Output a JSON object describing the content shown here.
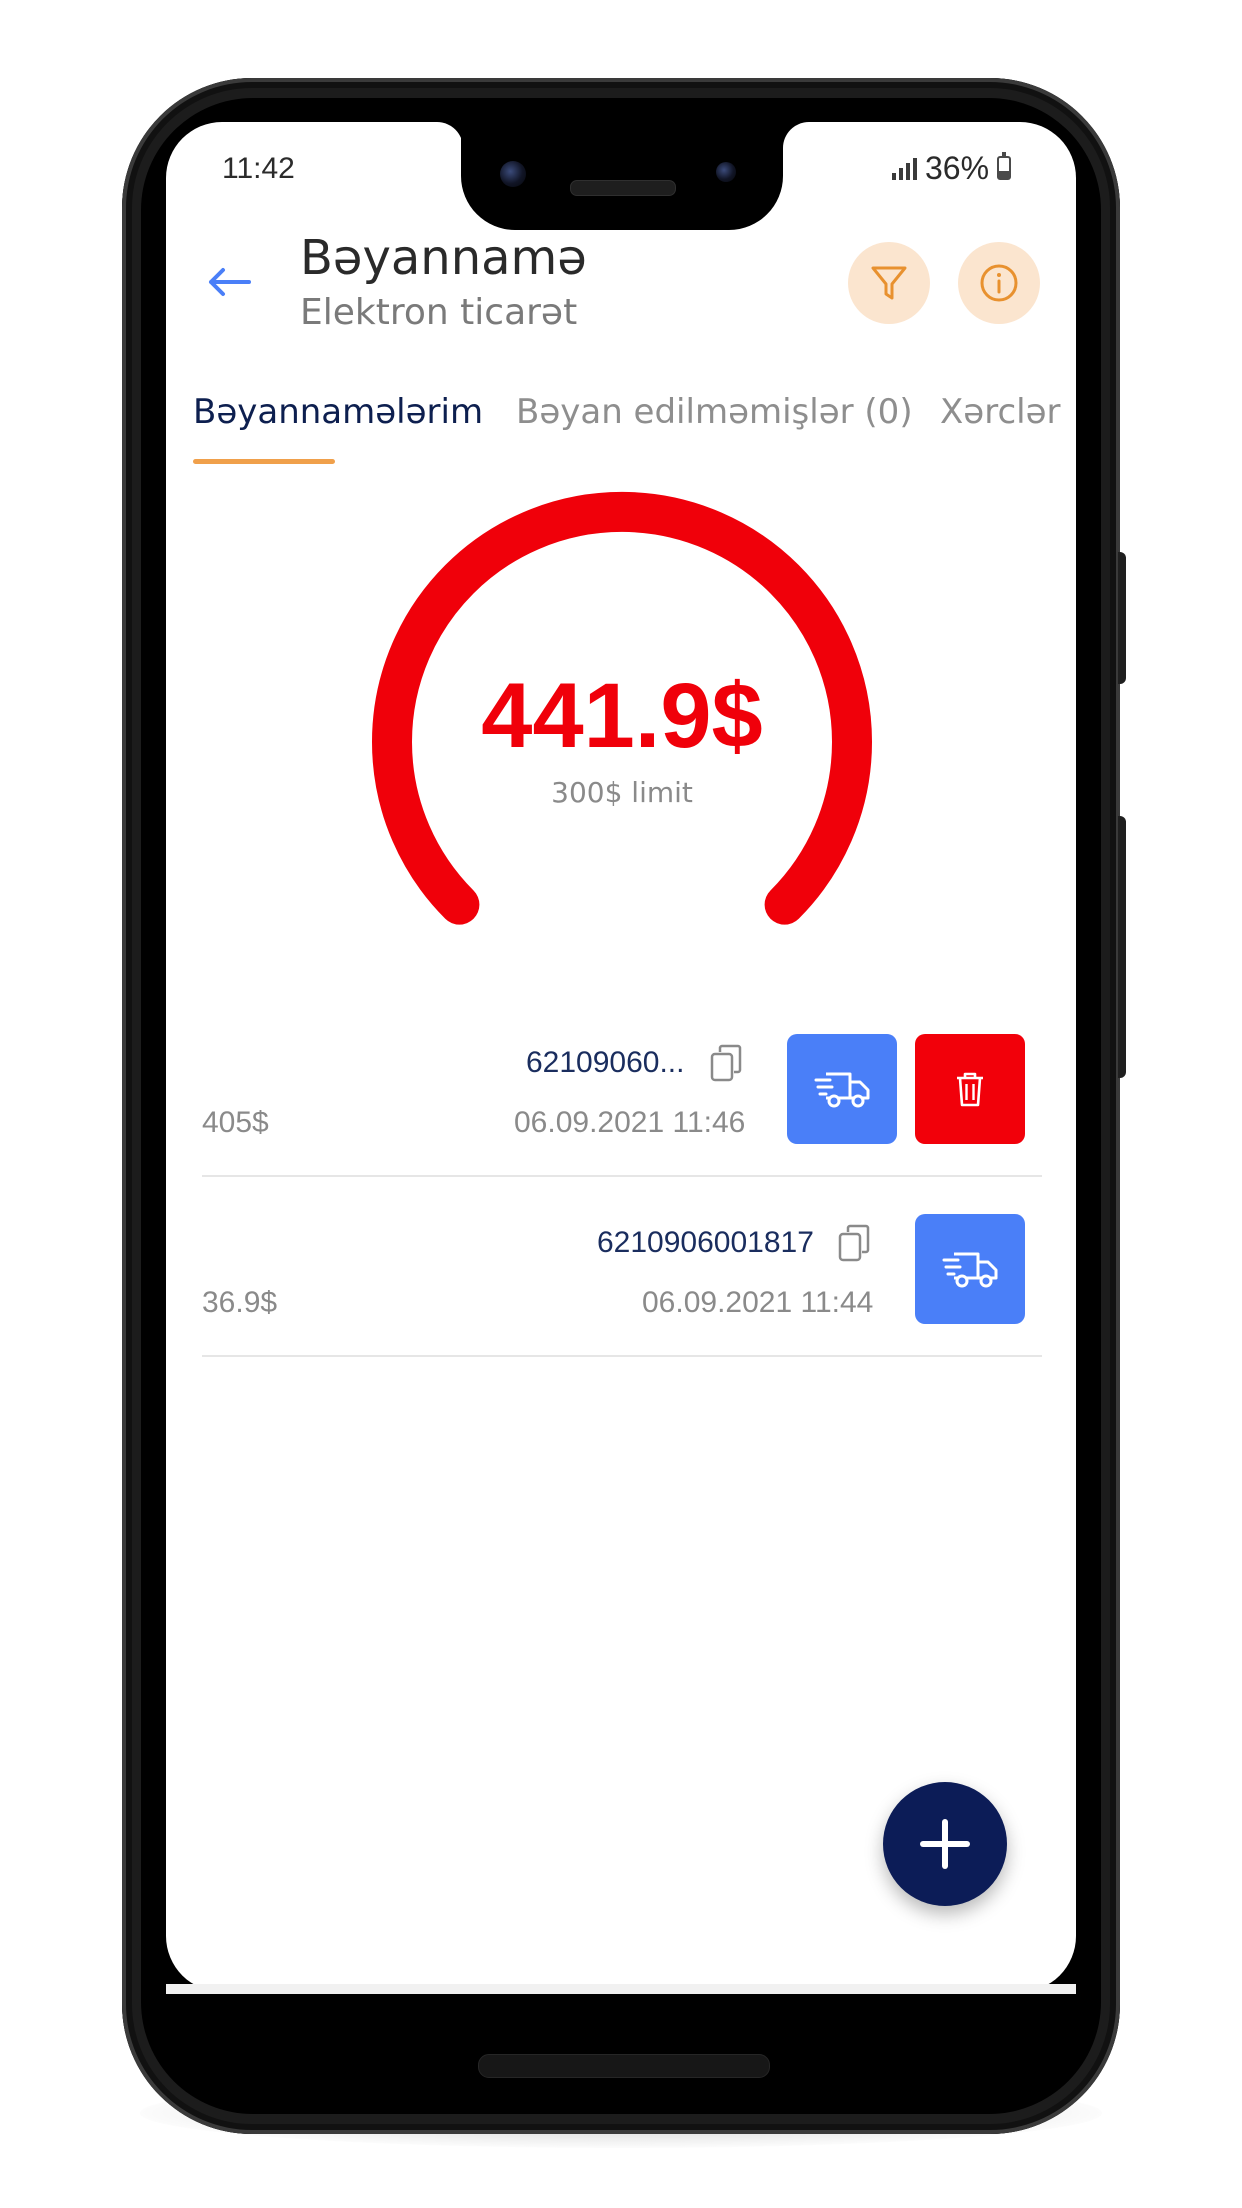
{
  "status_bar": {
    "time": "11:42",
    "battery_percent": "36%",
    "battery_level": 0.36,
    "signal_bars": 4
  },
  "header": {
    "title": "Bəyannamə",
    "subtitle": "Elektron ticarət",
    "back_icon": "arrow-left-icon",
    "filter_icon": "filter-icon",
    "info_icon": "info-icon"
  },
  "tabs": [
    {
      "label": "Bəyannamələrim",
      "active": true
    },
    {
      "label": "Bəyan edilməmişlər (0)",
      "active": false
    },
    {
      "label": "Xərclər",
      "active": false
    }
  ],
  "gauge": {
    "value": "441.9$",
    "limit_label": "300$ limit",
    "amount": 441.9,
    "limit": 300,
    "color": "#f0000a"
  },
  "declarations": [
    {
      "code": "62109060...",
      "amount": "405$",
      "date": "06.09.2021 11:46",
      "actions": [
        "truck-icon",
        "trash-icon"
      ]
    },
    {
      "code": "6210906001817",
      "amount": "36.9$",
      "date": "06.09.2021 11:44",
      "actions": [
        "truck-icon"
      ]
    }
  ],
  "fab": {
    "icon": "plus-icon"
  },
  "colors": {
    "accent_blue": "#4a7ff8",
    "danger_red": "#f2000a",
    "navy": "#0c1c57",
    "tab_indicator": "#f0a04b",
    "icon_bg": "#fbe5cf",
    "icon_orange": "#e8912f"
  }
}
